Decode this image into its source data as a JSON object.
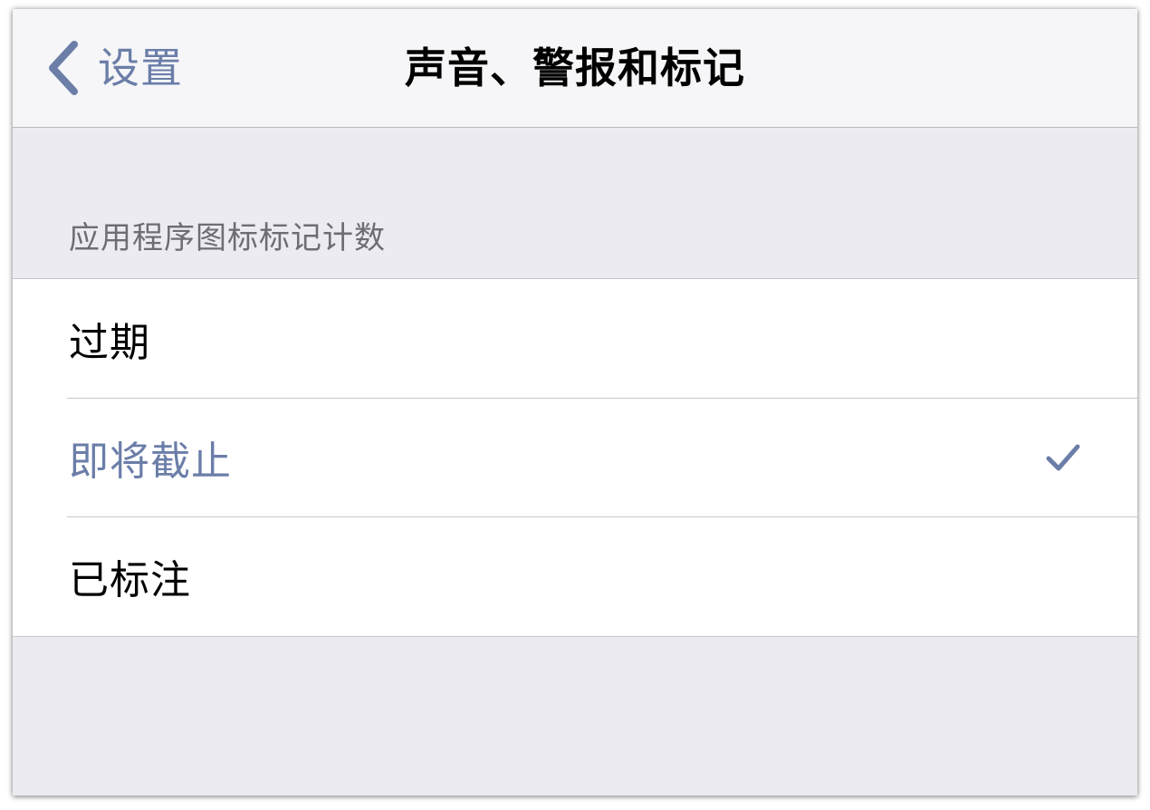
{
  "navbar": {
    "back_label": "设置",
    "title": "声音、警报和标记"
  },
  "section": {
    "header": "应用程序图标标记计数",
    "items": [
      {
        "label": "过期",
        "selected": false
      },
      {
        "label": "即将截止",
        "selected": true
      },
      {
        "label": "已标注",
        "selected": false
      }
    ]
  },
  "icons": {
    "back": "chevron-left-icon",
    "selected": "checkmark-icon"
  },
  "colors": {
    "accent": "#6b7ea8",
    "background": "#ebebf1",
    "navbar": "#f6f6f8",
    "section_header_text": "#6d6d72"
  }
}
